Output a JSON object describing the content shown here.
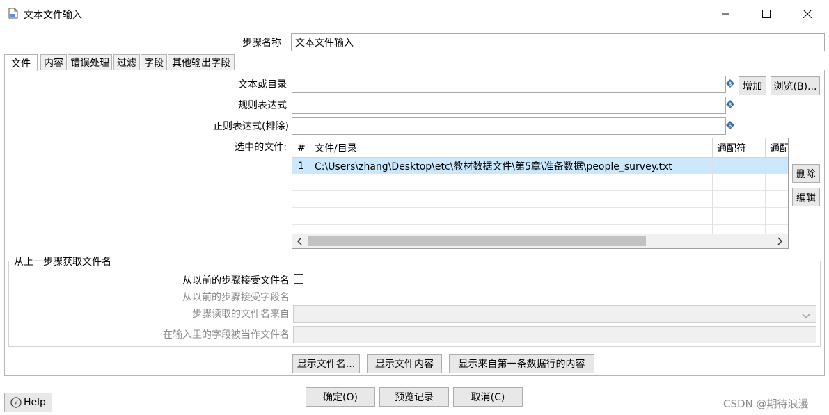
{
  "window": {
    "title": "文本文件输入",
    "minimize_glyph": "—",
    "maximize_glyph": "☐",
    "close_glyph": "✕"
  },
  "step_name": {
    "label": "步骤名称",
    "value": "文本文件输入"
  },
  "tabs": [
    {
      "label": "文件",
      "active": true
    },
    {
      "label": "内容"
    },
    {
      "label": "错误处理"
    },
    {
      "label": "过滤"
    },
    {
      "label": "字段"
    },
    {
      "label": "其他输出字段"
    }
  ],
  "file_tab": {
    "file_or_dir_label": "文本或目录",
    "regex_label": "规则表达式",
    "regex_exclude_label": "正则表达式(排除)",
    "selected_files_label": "选中的文件:",
    "add_button": "增加",
    "browse_button": "浏览(B)...",
    "delete_button": "删除",
    "edit_button": "编辑",
    "table": {
      "columns": [
        "#",
        "文件/目录",
        "通配符",
        "通配"
      ],
      "rows": [
        [
          "1",
          "C:\\Users\\zhang\\Desktop\\etc\\教材数据文件\\第5章\\准备数据\\people_survey.txt",
          "",
          ""
        ]
      ]
    }
  },
  "prev_step_group": {
    "title": "从上一步骤获取文件名",
    "accept_filenames_label": "从以前的步骤接受文件名",
    "accept_fieldnames_label": "从以前的步骤接受字段名",
    "step_source_label": "步骤读取的文件名来自",
    "field_as_filename_label": "在输入里的字段被当作文件名"
  },
  "panel_buttons": {
    "show_filenames": "显示文件名...",
    "show_file_content": "显示文件内容",
    "show_first_row": "显示来自第一条数据行的内容"
  },
  "footer": {
    "help": "Help",
    "ok": "确定(O)",
    "preview": "预览记录",
    "cancel": "取消(C)",
    "watermark": "CSDN @期待浪漫"
  },
  "colors": {
    "selection_row": "#cce8ff",
    "variable_icon": "#3a6ea5"
  },
  "icons": {
    "window_icon": "document-icon",
    "variable_icon": "variable-diamond-icon",
    "help_icon": "question-circle-icon"
  }
}
